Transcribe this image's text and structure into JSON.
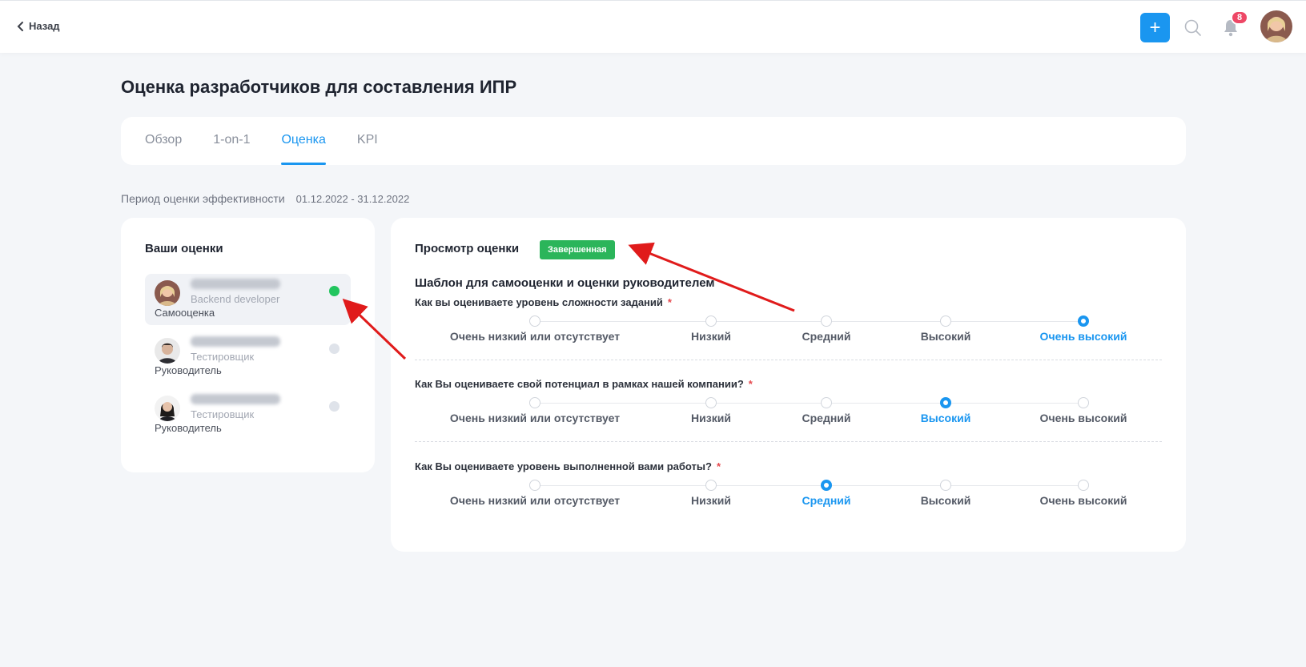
{
  "header": {
    "back_label": "Назад",
    "add_label": "+",
    "notification_count": "8"
  },
  "page": {
    "title": "Оценка разработчиков для составления ИПР"
  },
  "tabs": [
    {
      "label": "Обзор"
    },
    {
      "label": "1-on-1"
    },
    {
      "label": "Оценка"
    },
    {
      "label": "KPI"
    }
  ],
  "period": {
    "label": "Период оценки эффективности",
    "value": "01.12.2022 - 31.12.2022"
  },
  "evaluations": {
    "title": "Ваши оценки",
    "items": [
      {
        "role": "Backend developer",
        "type": "Самооценка",
        "status_color": "#22c55e"
      },
      {
        "role": "Тестировщик",
        "type": "Руководитель",
        "status_color": "#dfe3ea"
      },
      {
        "role": "Тестировщик",
        "type": "Руководитель",
        "status_color": "#dfe3ea"
      }
    ]
  },
  "view": {
    "title": "Просмотр оценки",
    "status": "Завершенная",
    "status_color": "#2bb55a",
    "template_title": "Шаблон для самооценки и оценки руководителем",
    "scale": [
      "Очень низкий или отсутствует",
      "Низкий",
      "Средний",
      "Высокий",
      "Очень высокий"
    ],
    "questions": [
      {
        "text": "Как вы оцениваете уровень сложности заданий",
        "required": "*",
        "selected": "Очень высокий"
      },
      {
        "text": "Как Вы оцениваете свой потенциал в рамках нашей компании?",
        "required": "*",
        "selected": "Высокий"
      },
      {
        "text": "Как Вы оцениваете уровень выполненной вами работы?",
        "required": "*",
        "selected": "Средний"
      }
    ]
  },
  "colors": {
    "accent": "#1a96f0",
    "annotation_arrow": "#e01b1b"
  }
}
